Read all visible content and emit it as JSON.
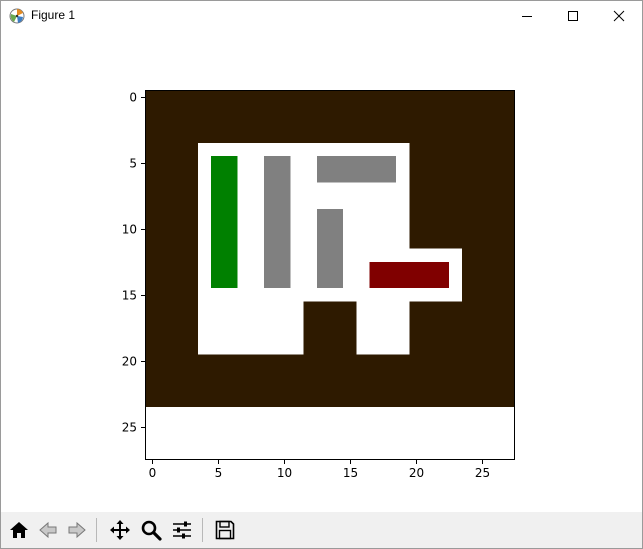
{
  "window": {
    "title": "Figure 1"
  },
  "icons": {
    "app": "matplotlib-icon",
    "minimize": "minimize-icon",
    "maximize": "maximize-icon",
    "close": "close-icon"
  },
  "toolbar": {
    "buttons": [
      "home-icon",
      "back-arrow-icon",
      "forward-arrow-icon",
      "pan-move-icon",
      "zoom-magnifier-icon",
      "configure-subplots-icon",
      "save-disk-icon"
    ]
  },
  "chart_data": {
    "type": "heatmap",
    "grid_size": [
      28,
      28
    ],
    "extent": {
      "x": [
        -0.5,
        27.5
      ],
      "y": [
        27.5,
        -0.5
      ]
    },
    "x_ticks": [
      0,
      5,
      10,
      15,
      20,
      25
    ],
    "y_ticks": [
      0,
      5,
      10,
      15,
      20,
      25
    ],
    "colors": {
      "background": "#2e1a00",
      "open": "#ffffff",
      "wall": "#808080",
      "start": "#008000",
      "goal": "#800000"
    },
    "regions": [
      {
        "name": "lower-band",
        "color": "open",
        "rows": [
          24,
          27
        ],
        "cols": [
          0,
          27
        ]
      },
      {
        "name": "room-main",
        "color": "open",
        "rows": [
          4,
          15
        ],
        "cols": [
          4,
          19
        ]
      },
      {
        "name": "room-right-extension",
        "color": "open",
        "rows": [
          12,
          15
        ],
        "cols": [
          20,
          23
        ]
      },
      {
        "name": "room-left-lower",
        "color": "open",
        "rows": [
          16,
          19
        ],
        "cols": [
          4,
          11
        ]
      },
      {
        "name": "room-center-lower",
        "color": "open",
        "rows": [
          16,
          19
        ],
        "cols": [
          16,
          19
        ]
      },
      {
        "name": "green-bar",
        "color": "start",
        "rows": [
          5,
          14
        ],
        "cols": [
          5,
          6
        ]
      },
      {
        "name": "gray-vertical-1",
        "color": "wall",
        "rows": [
          5,
          14
        ],
        "cols": [
          9,
          10
        ]
      },
      {
        "name": "gray-horizontal",
        "color": "wall",
        "rows": [
          5,
          6
        ],
        "cols": [
          13,
          18
        ]
      },
      {
        "name": "gray-vertical-2",
        "color": "wall",
        "rows": [
          9,
          14
        ],
        "cols": [
          13,
          14
        ]
      },
      {
        "name": "red-bar",
        "color": "goal",
        "rows": [
          13,
          14
        ],
        "cols": [
          17,
          22
        ]
      }
    ]
  }
}
